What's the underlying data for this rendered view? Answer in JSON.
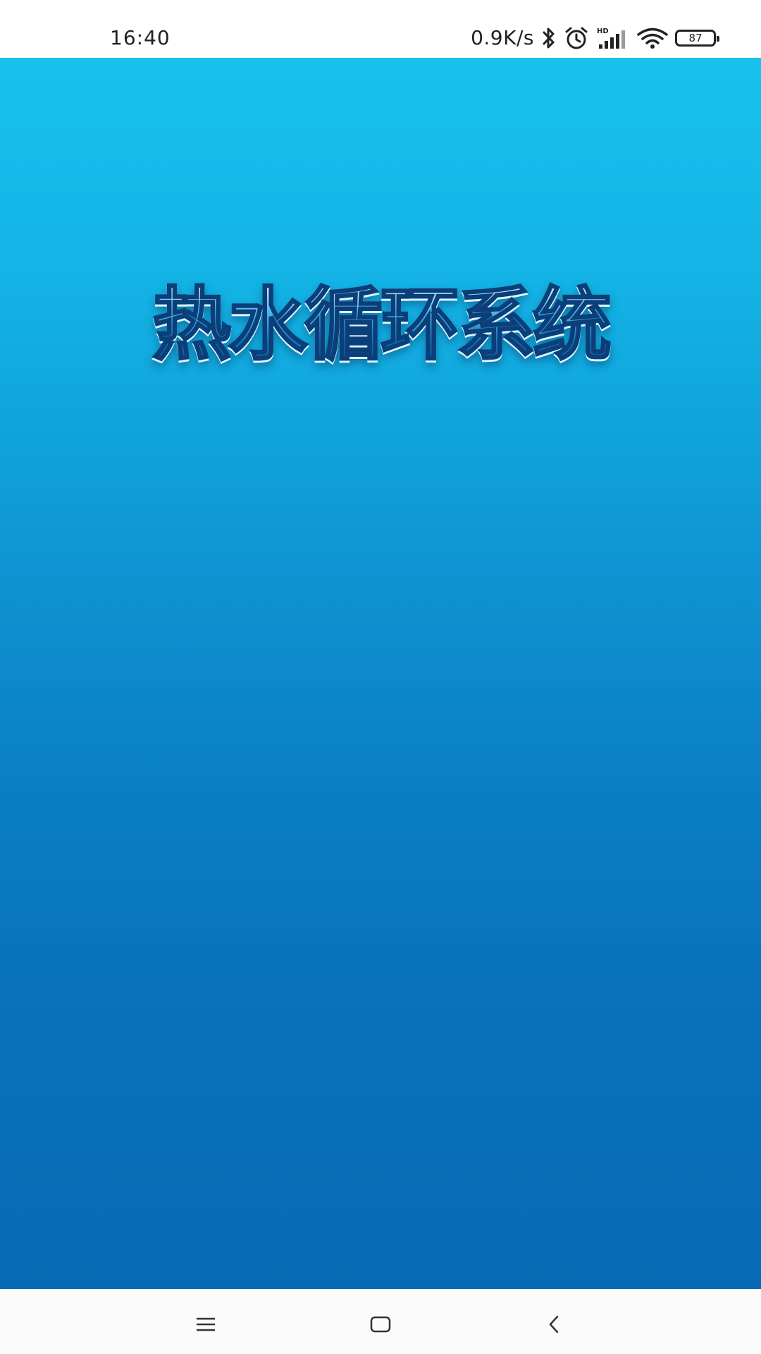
{
  "status_bar": {
    "time": "16:40",
    "net_speed": "0.9K/s",
    "battery_level": "87",
    "icons": [
      "bluetooth-icon",
      "alarm-icon",
      "hd-signal-icon",
      "wifi-icon",
      "battery-icon"
    ]
  },
  "splash": {
    "title": "热水循环系统",
    "colors": {
      "gradient_top": "#17c2ee",
      "gradient_bottom": "#066bb4",
      "title_stroke": "#0a3f7a"
    }
  },
  "nav_bar": {
    "buttons": [
      "menu-icon",
      "home-icon",
      "back-icon"
    ]
  }
}
